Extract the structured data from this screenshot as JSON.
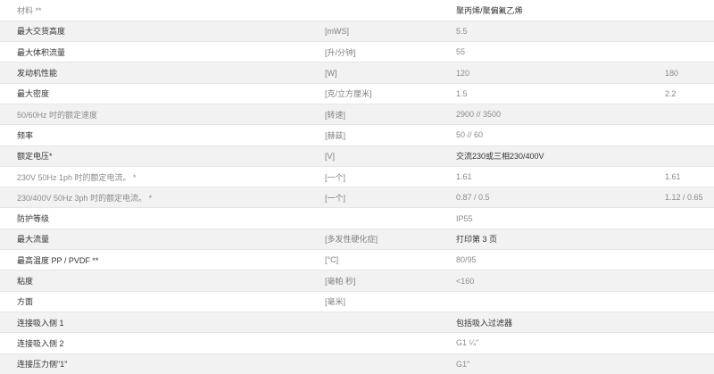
{
  "spec_table": {
    "rows": [
      {
        "label": "材料 **",
        "unit": "",
        "v1": "聚丙烯/聚偏氟乙烯",
        "v2": "",
        "muted_label": true,
        "dark_value": true
      },
      {
        "label": "最大交货高度",
        "unit": "[mWS]",
        "v1": "5.5",
        "v2": "",
        "muted_label": false,
        "dark_value": false
      },
      {
        "label": "最大体积流量",
        "unit": "[升/分钟]",
        "v1": "55",
        "v2": "",
        "muted_label": false,
        "dark_value": false
      },
      {
        "label": "发动机性能",
        "unit": "[W]",
        "v1": "120",
        "v2": "180",
        "muted_label": false,
        "dark_value": false
      },
      {
        "label": "最大密度",
        "unit": "[克/立方厘米]",
        "v1": "1.5",
        "v2": "2.2",
        "muted_label": false,
        "dark_value": false
      },
      {
        "label": "50/60Hz 时的额定速度",
        "unit": "[转速]",
        "v1": "2900 // 3500",
        "v2": "",
        "muted_label": true,
        "dark_value": false
      },
      {
        "label": "频率",
        "unit": "[赫兹]",
        "v1": "50 // 60",
        "v2": "",
        "muted_label": false,
        "dark_value": false
      },
      {
        "label": "额定电压*",
        "unit": "[V]",
        "v1": "交流230或三相230/400V",
        "v2": "",
        "muted_label": false,
        "dark_value": true
      },
      {
        "label": "230V 50Hz 1ph 时的额定电流。 *",
        "unit": "[一个]",
        "v1": "1.61",
        "v2": "1.61",
        "muted_label": true,
        "dark_value": false
      },
      {
        "label": "230/400V 50Hz 3ph 时的额定电流。 *",
        "unit": "[一个]",
        "v1": "0.87 / 0.5",
        "v2": "1.12 / 0.65",
        "muted_label": true,
        "dark_value": false
      },
      {
        "label": "防护等级",
        "unit": "",
        "v1": "IP55",
        "v2": "",
        "muted_label": false,
        "dark_value": false
      },
      {
        "label": "最大流量",
        "unit": "[多发性硬化症]",
        "v1": "打印第 3 页",
        "v2": "",
        "muted_label": false,
        "dark_value": true
      },
      {
        "label": "最高温度 PP / PVDF **",
        "unit": "[°C]",
        "v1": "80/95",
        "v2": "",
        "muted_label": false,
        "dark_value": false
      },
      {
        "label": "粘度",
        "unit": "[毫帕 秒]",
        "v1": "<160",
        "v2": "",
        "muted_label": false,
        "dark_value": false
      },
      {
        "label": "方面",
        "unit": "[毫米]",
        "v1": "",
        "v2": "",
        "muted_label": false,
        "dark_value": false
      },
      {
        "label": "连接吸入侧 1",
        "unit": "",
        "v1": "包括吸入过滤器",
        "v2": "",
        "muted_label": false,
        "dark_value": true
      },
      {
        "label": "连接吸入侧 2",
        "unit": "",
        "v1": "G1 ¼\"",
        "v2": "",
        "muted_label": false,
        "dark_value": false
      },
      {
        "label": "连接压力侧\"1\"",
        "unit": "",
        "v1": "G1\"",
        "v2": "",
        "muted_label": false,
        "dark_value": false
      }
    ]
  }
}
